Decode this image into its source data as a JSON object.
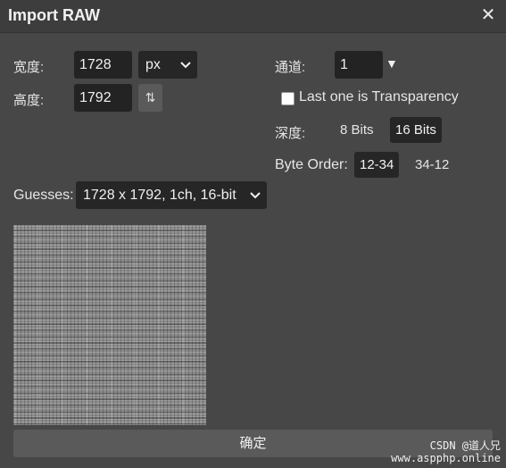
{
  "dialog": {
    "title": "Import RAW",
    "close_icon": "close-icon"
  },
  "width": {
    "label": "宽度:",
    "value": "1728",
    "unit": "px"
  },
  "height": {
    "label": "高度:",
    "value": "1792",
    "swap_icon": "swap-vertical-icon",
    "swap_glyph": "⇅"
  },
  "channels": {
    "label": "通道:",
    "value": "1",
    "dropdown_glyph": "▼"
  },
  "transparency": {
    "label": "Last one is Transparency",
    "checked": false
  },
  "depth": {
    "label": "深度:",
    "options": [
      "8 Bits",
      "16 Bits"
    ],
    "selected": "16 Bits"
  },
  "byte_order": {
    "label": "Byte Order:",
    "options": [
      "12-34",
      "34-12"
    ],
    "selected": "12-34"
  },
  "guesses": {
    "label": "Guesses:",
    "value": "1728 x 1792, 1ch, 16-bit"
  },
  "confirm_button": "确定",
  "watermark": {
    "line1": "CSDN @道人兄",
    "line2": "www.aspphp.online"
  },
  "colors": {
    "background": "#474747",
    "titlebar": "#3d3d3d",
    "field": "#232323",
    "button": "#5a5a5a"
  }
}
